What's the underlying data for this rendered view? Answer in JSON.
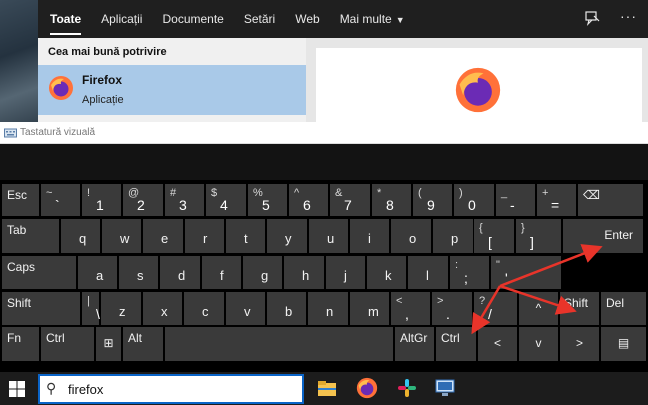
{
  "search": {
    "tabs": [
      {
        "label": "Toate",
        "active": true
      },
      {
        "label": "Aplicații"
      },
      {
        "label": "Documente"
      },
      {
        "label": "Setări"
      },
      {
        "label": "Web"
      },
      {
        "label": "Mai multe"
      }
    ],
    "icons": [
      "feedback-icon",
      "more-options-icon"
    ],
    "best_match_title": "Cea mai bună potrivire",
    "best_match": {
      "name": "Firefox",
      "kind": "Aplicație",
      "icon": "firefox-icon"
    }
  },
  "osk": {
    "title": "Tastatură vizuală",
    "row1": [
      {
        "id": "esc",
        "lbl": "Esc"
      },
      {
        "id": "tilde",
        "a": "~",
        "b": "`"
      },
      {
        "id": "1",
        "a": "!",
        "b": "1"
      },
      {
        "id": "2",
        "a": "@",
        "b": "2"
      },
      {
        "id": "3",
        "a": "#",
        "b": "3"
      },
      {
        "id": "4",
        "a": "$",
        "b": "4"
      },
      {
        "id": "5",
        "a": "%",
        "b": "5"
      },
      {
        "id": "6",
        "a": "^",
        "b": "6"
      },
      {
        "id": "7",
        "a": "&",
        "b": "7"
      },
      {
        "id": "8",
        "a": "*",
        "b": "8"
      },
      {
        "id": "9",
        "a": "(",
        "b": "9"
      },
      {
        "id": "0",
        "a": ")",
        "b": "0"
      },
      {
        "id": "minus",
        "a": "_",
        "b": "-"
      },
      {
        "id": "equals",
        "a": "+",
        "b": "="
      },
      {
        "id": "backspace",
        "lbl": "⌫"
      }
    ],
    "row2": [
      {
        "id": "tab",
        "lbl": "Tab"
      },
      {
        "id": "q",
        "c": "q"
      },
      {
        "id": "w",
        "c": "w"
      },
      {
        "id": "e",
        "c": "e"
      },
      {
        "id": "r",
        "c": "r"
      },
      {
        "id": "t",
        "c": "t"
      },
      {
        "id": "y",
        "c": "y"
      },
      {
        "id": "u",
        "c": "u"
      },
      {
        "id": "i",
        "c": "i"
      },
      {
        "id": "o",
        "c": "o"
      },
      {
        "id": "p",
        "c": "p"
      },
      {
        "id": "lbracket",
        "a": "{",
        "b": "["
      },
      {
        "id": "rbracket",
        "a": "}",
        "b": "]"
      },
      {
        "id": "enter",
        "lbl": "Enter"
      }
    ],
    "row3": [
      {
        "id": "caps",
        "lbl": "Caps"
      },
      {
        "id": "a",
        "c": "a"
      },
      {
        "id": "s",
        "c": "s"
      },
      {
        "id": "d",
        "c": "d"
      },
      {
        "id": "f",
        "c": "f"
      },
      {
        "id": "g",
        "c": "g"
      },
      {
        "id": "h",
        "c": "h"
      },
      {
        "id": "j",
        "c": "j"
      },
      {
        "id": "k",
        "c": "k"
      },
      {
        "id": "l",
        "c": "l"
      },
      {
        "id": "semicolon",
        "a": ":",
        "b": ";"
      },
      {
        "id": "quote",
        "a": "\"",
        "b": "'"
      }
    ],
    "row4": [
      {
        "id": "shift-left",
        "lbl": "Shift"
      },
      {
        "id": "backslash",
        "a": "|",
        "b": "\\"
      },
      {
        "id": "z",
        "c": "z"
      },
      {
        "id": "x",
        "c": "x"
      },
      {
        "id": "c",
        "c": "c"
      },
      {
        "id": "v",
        "c": "v"
      },
      {
        "id": "b",
        "c": "b"
      },
      {
        "id": "n",
        "c": "n"
      },
      {
        "id": "m",
        "c": "m"
      },
      {
        "id": "comma",
        "a": "<",
        "b": ","
      },
      {
        "id": "period",
        "a": ">",
        "b": "."
      },
      {
        "id": "slash",
        "a": "?",
        "b": "/"
      },
      {
        "id": "up",
        "lbl": "^"
      },
      {
        "id": "shift-right",
        "lbl": "Shift"
      },
      {
        "id": "del",
        "lbl": "Del"
      }
    ],
    "row5": [
      {
        "id": "fn",
        "lbl": "Fn"
      },
      {
        "id": "ctrl-left",
        "lbl": "Ctrl"
      },
      {
        "id": "win",
        "lbl": "⊞"
      },
      {
        "id": "alt",
        "lbl": "Alt"
      },
      {
        "id": "space",
        "lbl": ""
      },
      {
        "id": "altgr",
        "lbl": "AltGr"
      },
      {
        "id": "ctrl-right",
        "lbl": "Ctrl"
      },
      {
        "id": "left",
        "lbl": "<"
      },
      {
        "id": "down",
        "lbl": "v"
      },
      {
        "id": "right",
        "lbl": ">"
      },
      {
        "id": "menu",
        "lbl": "▤"
      }
    ]
  },
  "taskbar": {
    "search_text": "firefox",
    "apps": [
      "file-explorer-icon",
      "firefox-icon",
      "slack-icon",
      "remote-desktop-icon"
    ]
  },
  "colors": {
    "accent": "#0a64c8",
    "selection": "#a9c9e8",
    "key": "#3a3a3a",
    "arrow": "#e8342a"
  }
}
